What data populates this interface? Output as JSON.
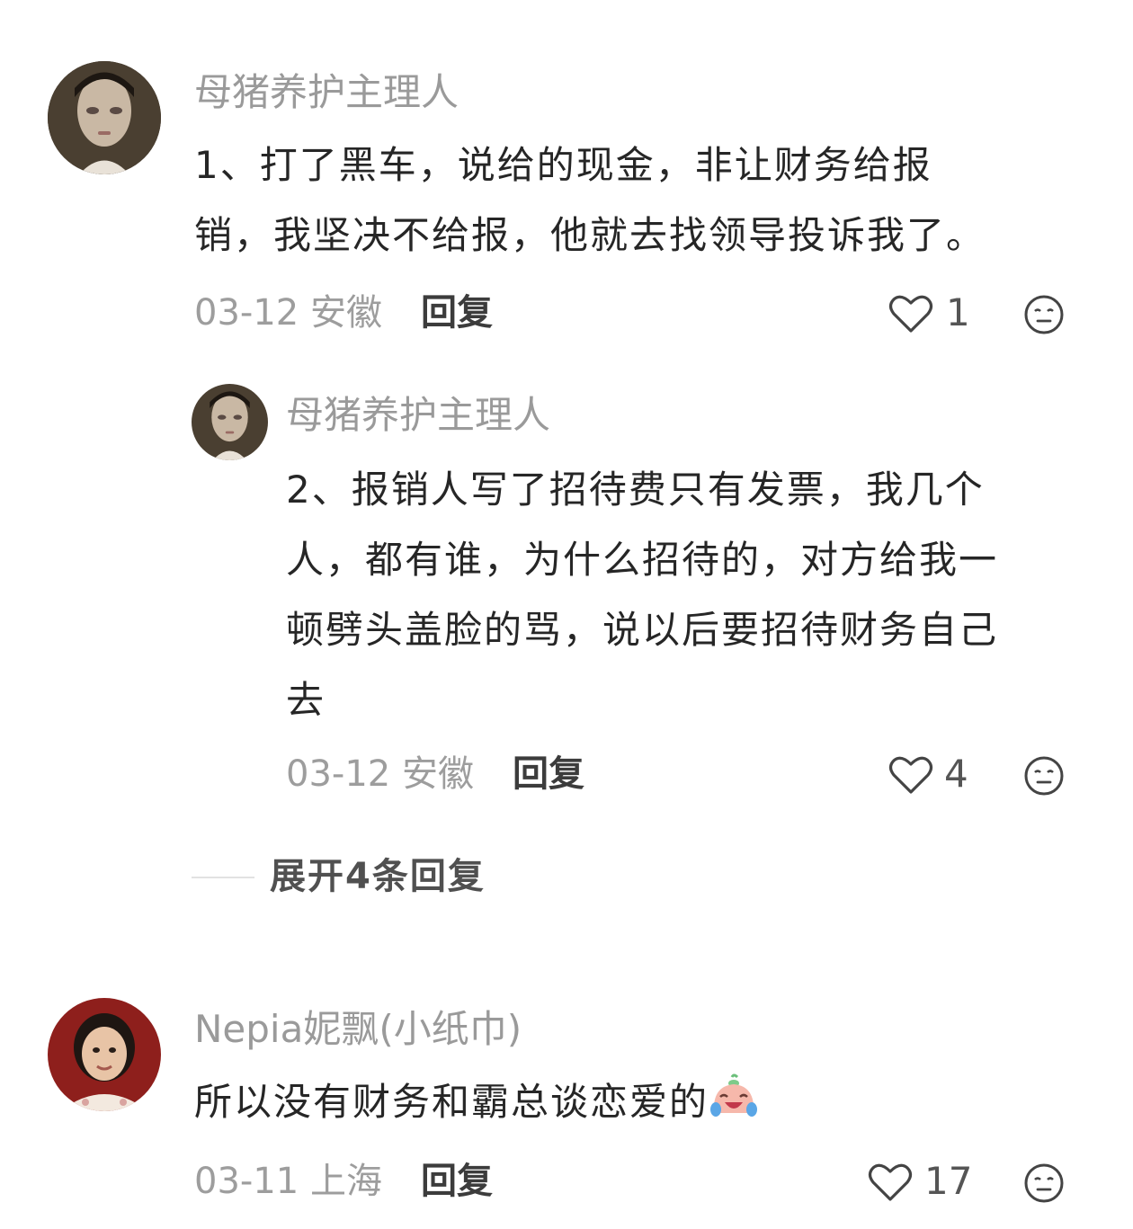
{
  "comments": [
    {
      "username": "母猪养护主理人",
      "avatar_icon": "portrait-dark-hair-avatar",
      "text_lines": [
        "1、打了黑车，说给的现金，非让财务给报",
        "销，我坚决不给报，他就去找领导投诉我了。"
      ],
      "date": "03-12 安徽",
      "reply_label": "回复",
      "likes": "1",
      "replies": [
        {
          "username": "母猪养护主理人",
          "avatar_icon": "portrait-dark-hair-avatar",
          "text_lines": [
            "2、报销人写了招待费只有发票，我几个",
            "人，都有谁，为什么招待的，对方给我一",
            "顿劈头盖脸的骂，说以后要招待财务自己",
            "去"
          ],
          "date": "03-12 安徽",
          "reply_label": "回复",
          "likes": "4"
        }
      ],
      "expand_label": "展开4条回复"
    },
    {
      "username": "Nepia妮飘(小纸巾)",
      "avatar_icon": "child-portrait-avatar",
      "text": "所以没有财务和霸总谈恋爱的",
      "text_emoji": "crying-laughing-emoji",
      "date": "03-11 上海",
      "reply_label": "回复",
      "likes": "17"
    }
  ],
  "icons": {
    "like": "heart-outline-icon",
    "reaction": "neutral-face-icon"
  },
  "colors": {
    "username": "#9a9a9a",
    "text": "#262626",
    "meta": "#9d9d9d"
  }
}
